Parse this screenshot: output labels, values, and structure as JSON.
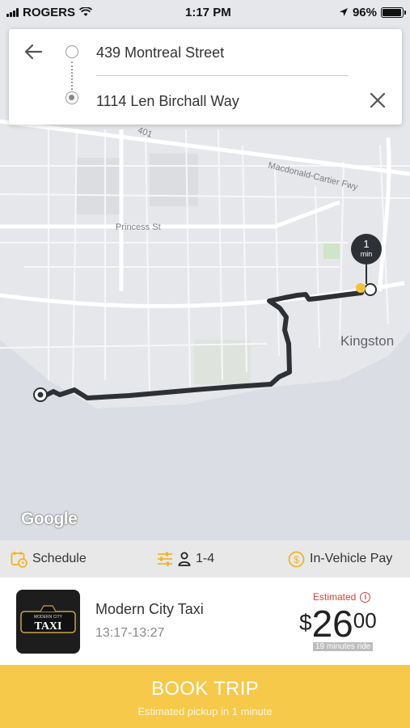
{
  "status_bar": {
    "carrier": "ROGERS",
    "time": "1:17 PM",
    "battery": "96%",
    "battery_level": 0.96
  },
  "trip": {
    "origin": "439 Montreal Street",
    "destination": "1114 Len Birchall Way"
  },
  "map": {
    "labels": {
      "highway_401": "401",
      "freeway": "Macdonald-Cartier Fwy",
      "street": "Princess St",
      "city": "Kingston",
      "attribution": "Google"
    },
    "eta_pin": {
      "value": "1",
      "unit": "min"
    },
    "route_color": "#2d3135",
    "pickup_color": "#f4c23a"
  },
  "options": {
    "schedule": "Schedule",
    "passengers": "1-4",
    "payment": "In-Vehicle Pay"
  },
  "taxi": {
    "logo_text": "MODERN CITY TAXI",
    "name": "Modern City Taxi",
    "time_window": "13:17-13:27",
    "estimated_label": "Estimated",
    "price_currency": "$",
    "price_whole": "26",
    "price_cents": "00",
    "ride_duration": "19 minutes ride"
  },
  "book": {
    "label": "BOOK TRIP",
    "subtitle": "Estimated pickup in 1 minute"
  },
  "colors": {
    "accent_yellow": "#f6c94a",
    "estimate_red": "#d0453a"
  }
}
